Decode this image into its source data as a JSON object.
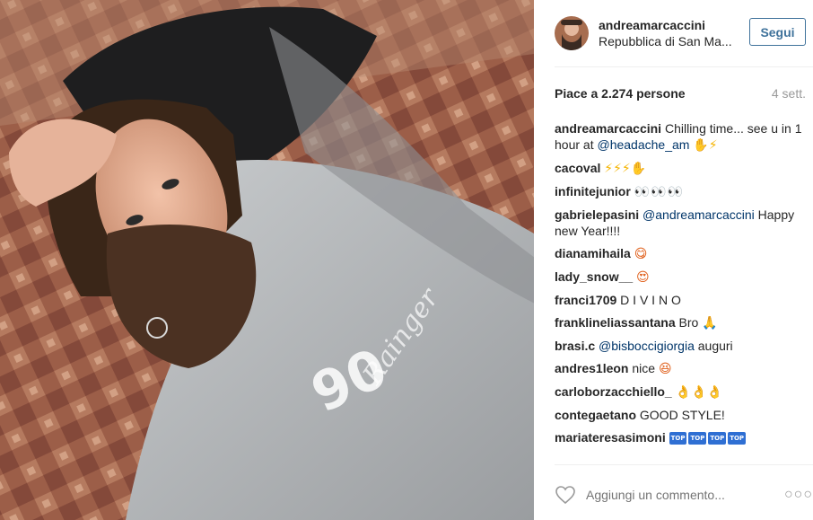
{
  "header": {
    "username": "andreamarcaccini",
    "location": "Repubblica di San Ma...",
    "follow_label": "Segui"
  },
  "stats": {
    "likes": "Piace a 2.274 persone",
    "age": "4 sett."
  },
  "comments": [
    {
      "user": "andreamarcaccini",
      "text": "Chilling time... see u in 1 hour at ",
      "mention": "@headache_am",
      "emoji": "✋⚡"
    },
    {
      "user": "cacoval",
      "text": "",
      "emoji": "⚡⚡⚡✋"
    },
    {
      "user": "infinitejunior",
      "text": "",
      "emoji": "👀👀👀"
    },
    {
      "user": "gabrielepasini",
      "text": " Happy new Year!!!!",
      "mention": "@andreamarcaccini",
      "emoji": ""
    },
    {
      "user": "dianamihaila",
      "text": "",
      "emoji": "😋"
    },
    {
      "user": "lady_snow__",
      "text": "",
      "emoji": "😍"
    },
    {
      "user": "franci1709",
      "text": "D I V I N O",
      "emoji": ""
    },
    {
      "user": "franklineliassantana",
      "text": "Bro",
      "emoji": "🙏"
    },
    {
      "user": "brasi.c",
      "text": " auguri",
      "mention": "@bisboccigiorgia",
      "emoji": ""
    },
    {
      "user": "andres1leon",
      "text": "nice",
      "emoji": "😆"
    },
    {
      "user": "carloborzacchiello_",
      "text": "",
      "emoji": "👌👌👌"
    },
    {
      "user": "contegaetano",
      "text": "GOOD STYLE!",
      "emoji": ""
    },
    {
      "user": "mariateresasimoni",
      "text": "",
      "emoji": "TOP TOP TOP TOP"
    }
  ],
  "footer": {
    "placeholder": "Aggiungi un commento...",
    "more": "○○○"
  },
  "icons": {
    "heart": "heart-icon",
    "more": "ellipsis-icon"
  },
  "colors": {
    "accent": "#3f729b",
    "mention": "#003569",
    "muted": "#999999"
  }
}
